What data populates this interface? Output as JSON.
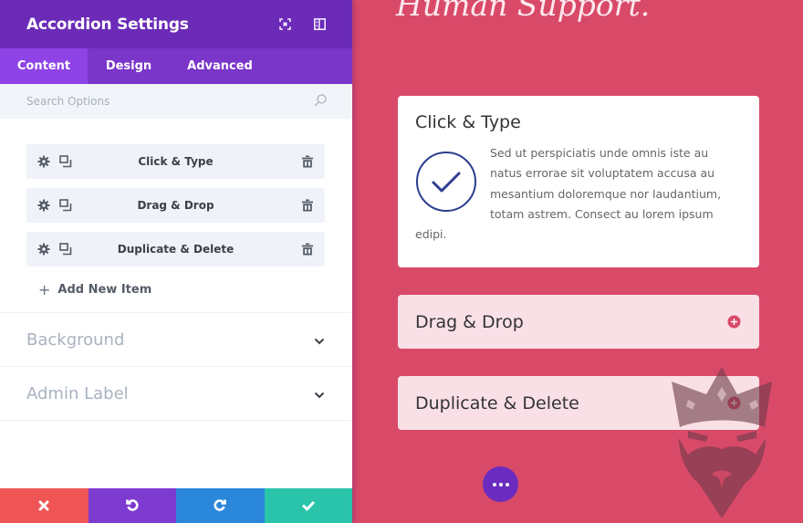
{
  "panel": {
    "title": "Accordion Settings",
    "header_icons": [
      "fullscreen-icon",
      "sidebar-layout-icon"
    ],
    "tabs": [
      {
        "label": "Content",
        "active": true
      },
      {
        "label": "Design",
        "active": false
      },
      {
        "label": "Advanced",
        "active": false
      }
    ],
    "search": {
      "placeholder": "Search Options",
      "value": ""
    },
    "items": [
      {
        "label": "Click & Type"
      },
      {
        "label": "Drag & Drop"
      },
      {
        "label": "Duplicate & Delete"
      }
    ],
    "add_item_label": "Add New Item",
    "toggles": [
      {
        "label": "Background"
      },
      {
        "label": "Admin Label"
      }
    ],
    "actions": [
      {
        "name": "discard",
        "icon": "close-icon",
        "color": "#ef5555"
      },
      {
        "name": "undo",
        "icon": "undo-icon",
        "color": "#7e3bd0"
      },
      {
        "name": "redo",
        "icon": "redo-icon",
        "color": "#2b87da"
      },
      {
        "name": "save",
        "icon": "check-icon",
        "color": "#29c4a9"
      }
    ],
    "colors": {
      "header": "#6b2bb7",
      "tabs": "#7a35c9",
      "active_tab": "#8d43e6"
    }
  },
  "preview": {
    "hero_title": "Human Support.",
    "accordion": [
      {
        "title": "Click & Type",
        "open": true,
        "body": "Sed ut perspiciatis unde omnis iste au natus errorae sit voluptatem accusa au mesantium doloremque nor laudantium, totam astrem. Consect au lorem ipsum edipi."
      },
      {
        "title": "Drag & Drop",
        "open": false
      },
      {
        "title": "Duplicate & Delete",
        "open": false
      }
    ],
    "colors": {
      "background": "#d94a69",
      "closed_item": "#f9e0e6",
      "accent": "#d94a69",
      "icon": "#2c3e8f",
      "fab": "#6b2bbf"
    }
  }
}
